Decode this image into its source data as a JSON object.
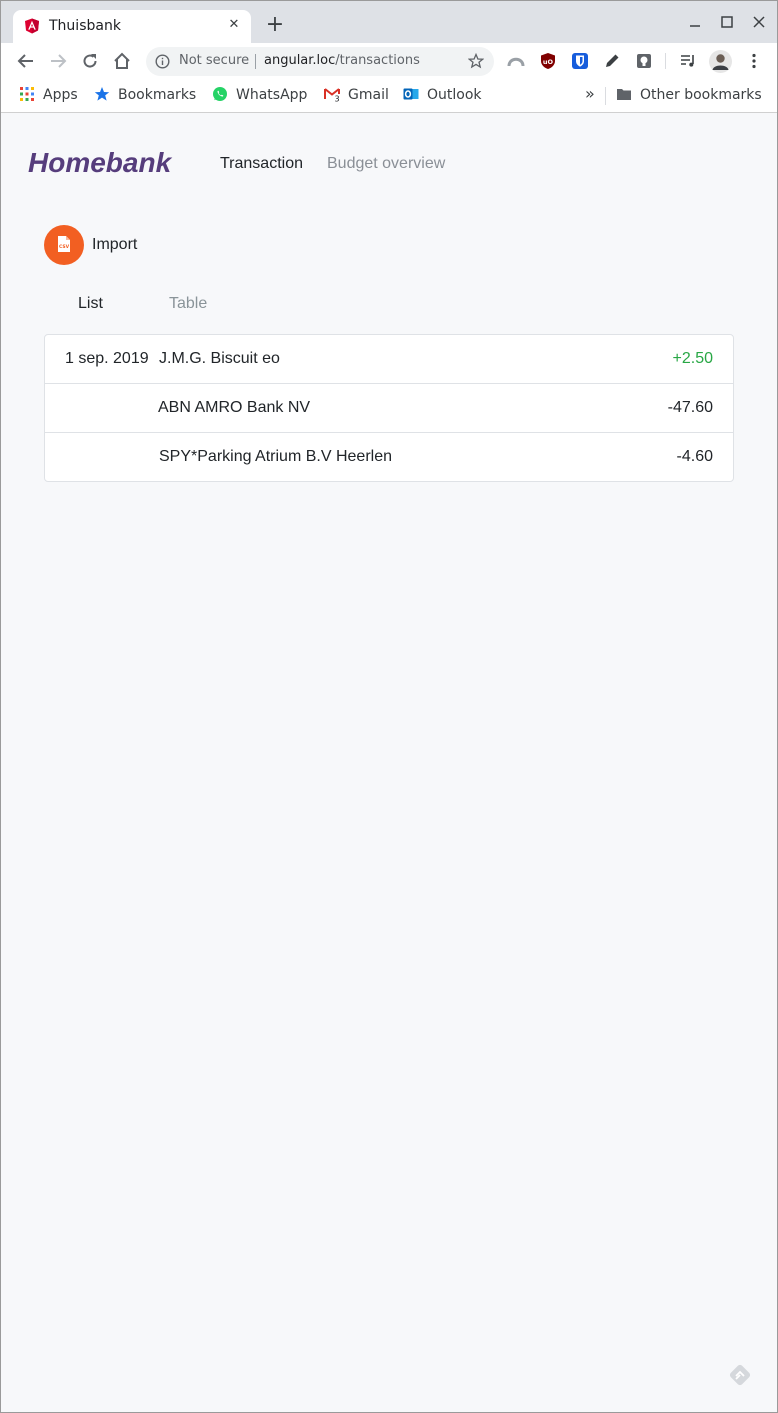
{
  "browser": {
    "tab_title": "Thuisbank",
    "new_tab_symbol": "+",
    "close_symbol": "✕",
    "omnibox": {
      "security_label": "Not secure",
      "url_host": "angular.loc",
      "url_path": "/transactions"
    },
    "bookmarks": [
      {
        "label": "Apps",
        "icon": "apps-grid-icon"
      },
      {
        "label": "Bookmarks",
        "icon": "star-icon"
      },
      {
        "label": "WhatsApp",
        "icon": "whatsapp-icon"
      },
      {
        "label": "Gmail",
        "icon": "gmail-icon"
      },
      {
        "label": "Outlook",
        "icon": "outlook-icon"
      }
    ],
    "overflow_symbol": "»",
    "other_bookmarks": "Other bookmarks"
  },
  "app": {
    "brand": "Homebank",
    "nav": [
      {
        "label": "Transaction",
        "active": true
      },
      {
        "label": "Budget overview",
        "active": false
      }
    ],
    "import_label": "Import",
    "view_tabs": [
      {
        "label": "List",
        "active": true
      },
      {
        "label": "Table",
        "active": false
      }
    ],
    "transactions": [
      {
        "date": "1 sep. 2019",
        "description": "J.M.G. Biscuit eo",
        "amount": "+2.50",
        "positive": true
      },
      {
        "date": "",
        "description": "ABN AMRO Bank NV",
        "amount": "-47.60",
        "positive": false
      },
      {
        "date": "",
        "description": "SPY*Parking Atrium B.V Heerlen",
        "amount": "-4.60",
        "positive": false
      }
    ]
  },
  "colors": {
    "brand": "#563d7c",
    "import_button": "#f25f22",
    "positive_amount": "#28a745",
    "page_background": "#f7f8fa"
  }
}
